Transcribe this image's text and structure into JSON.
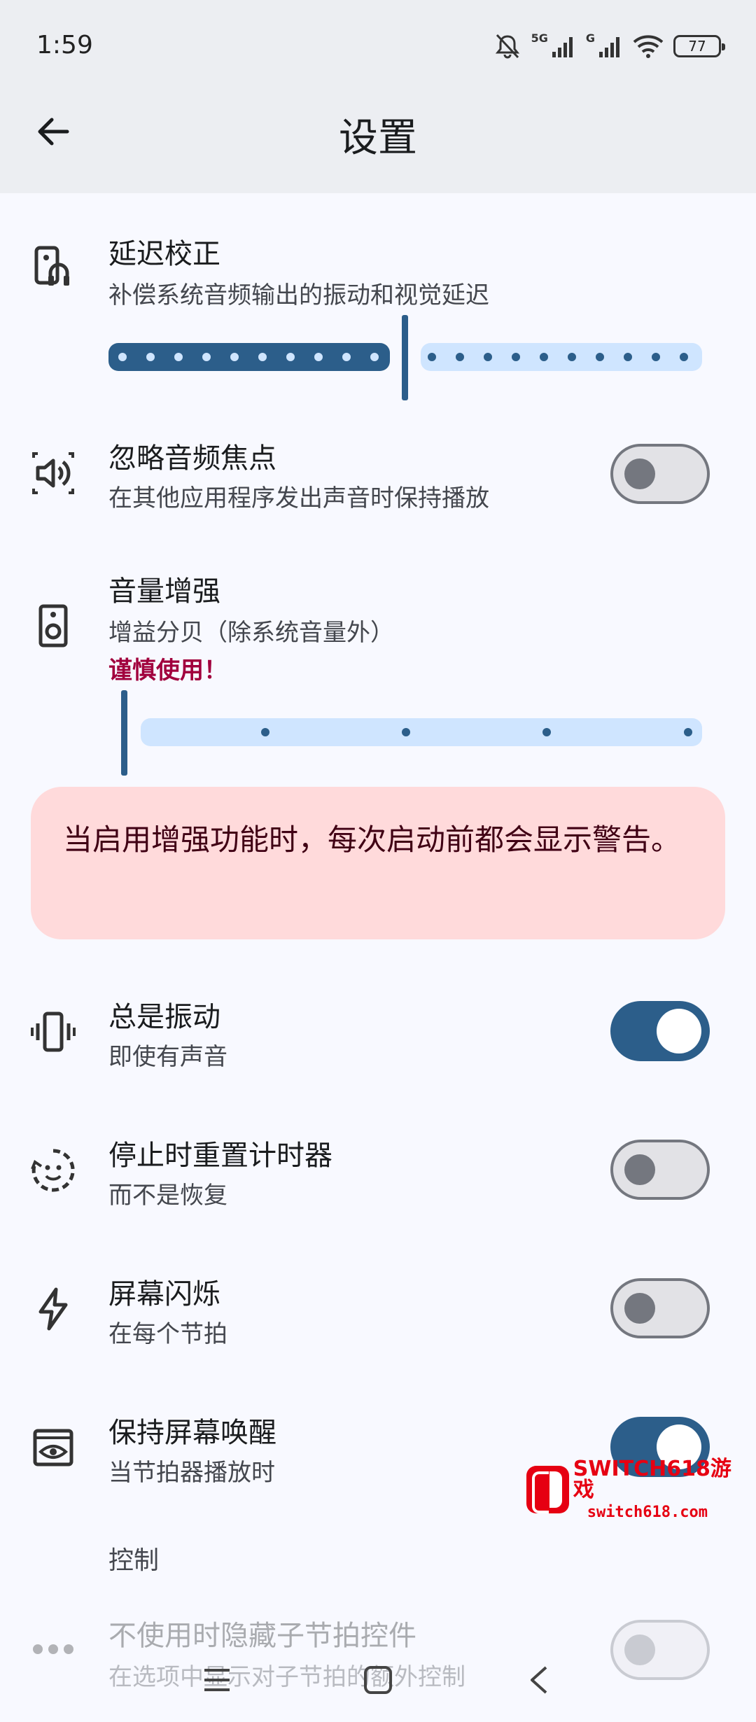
{
  "status": {
    "time": "1:59",
    "network": "5G",
    "network2": "G",
    "battery": "77"
  },
  "header": {
    "title": "设置"
  },
  "latency": {
    "title": "延迟校正",
    "subtitle": "补偿系统音频输出的振动和视觉延迟",
    "slider_value": 0.5
  },
  "audio_focus": {
    "title": "忽略音频焦点",
    "subtitle": "在其他应用程序发出声音时保持播放",
    "enabled": false
  },
  "gain": {
    "title": "音量增强",
    "subtitle": "增益分贝（除系统音量外）",
    "warning": "谨慎使用！",
    "slider_value": 0,
    "warning_card": "当启用增强功能时，每次启动前都会显示警告。"
  },
  "always_vibrate": {
    "title": "总是振动",
    "subtitle": "即使有声音",
    "enabled": true
  },
  "reset_timer": {
    "title": "停止时重置计时器",
    "subtitle": "而不是恢复",
    "enabled": false
  },
  "screen_flash": {
    "title": "屏幕闪烁",
    "subtitle": "在每个节拍",
    "enabled": false
  },
  "keep_awake": {
    "title": "保持屏幕唤醒",
    "subtitle": "当节拍器播放时",
    "enabled": true
  },
  "controls_section": {
    "label": "控制"
  },
  "hide_subdivisions": {
    "title": "不使用时隐藏子节拍控件",
    "subtitle": "在选项中显示对子节拍的额外控制",
    "enabled": false
  },
  "watermark": {
    "line1": "SWITCH618游戏",
    "line2": "switch618.com"
  },
  "icons": {
    "back": "arrow-left-icon",
    "latency": "phone-headphones-icon",
    "audio_focus": "speaker-icon",
    "gain": "speaker-box-icon",
    "vibrate": "vibrate-icon",
    "reset": "timer-reset-icon",
    "flash": "flash-icon",
    "awake": "eye-screen-icon",
    "more": "dots-icon"
  },
  "colors": {
    "accent": "#2c5e8a",
    "track_light": "#cfe5ff",
    "warning_text": "#a1003d",
    "warning_card": "#ffdadb"
  }
}
